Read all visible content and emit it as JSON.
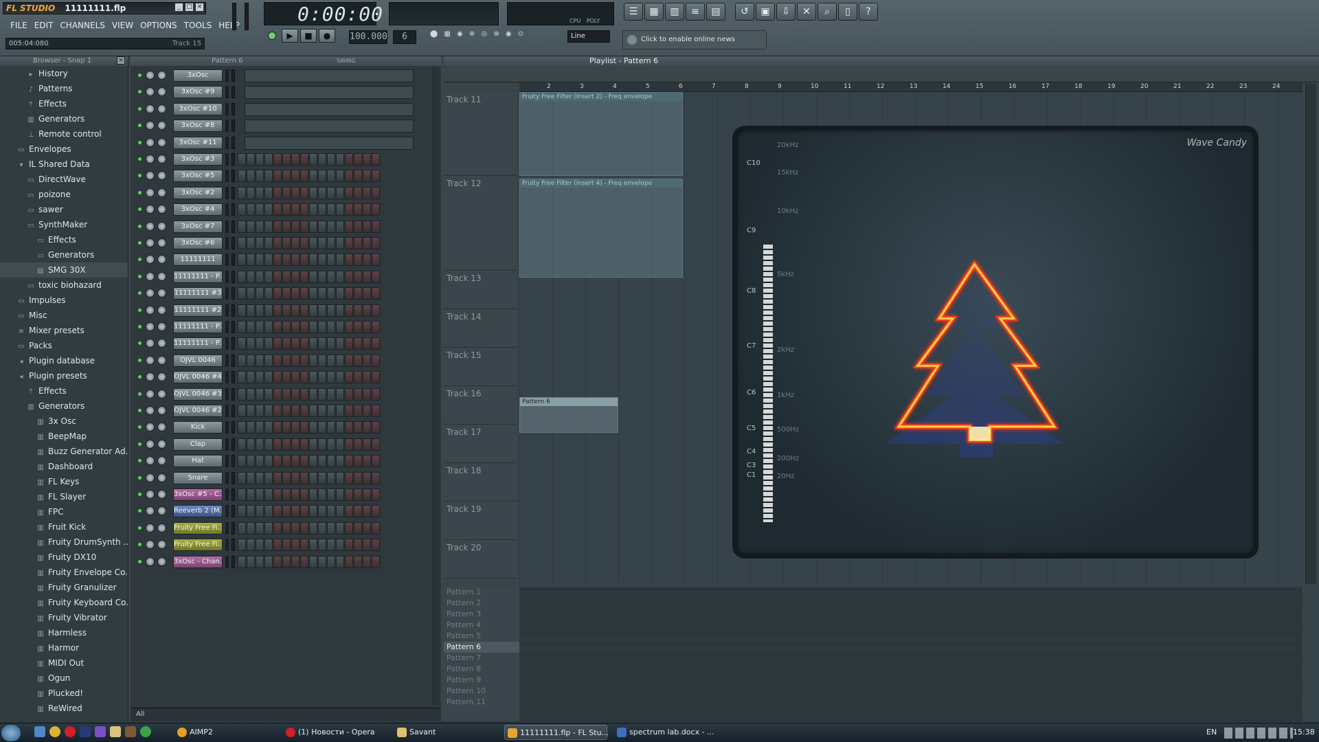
{
  "title_bar": {
    "app": "FL STUDIO",
    "file": "11111111.flp"
  },
  "menu": [
    "FILE",
    "EDIT",
    "CHANNELS",
    "VIEW",
    "OPTIONS",
    "TOOLS",
    "HELP"
  ],
  "hint": {
    "text": "005:04:080",
    "track": "Track 15"
  },
  "transport": {
    "time": "0:00:00",
    "tempo": "100.000",
    "pattern": "6",
    "snap": "Line",
    "cpu": "CPU",
    "poly": "POLY"
  },
  "news": "Click to enable online news",
  "browser": {
    "title": "Browser - Snap 1",
    "items": [
      "History",
      "Patterns",
      "Effects",
      "Generators",
      "Remote control",
      "Envelopes",
      "IL Shared Data",
      "DirectWave",
      "poizone",
      "sawer",
      "SynthMaker",
      "Effects",
      "Generators",
      "SMG 30X",
      "toxic biohazard",
      "Impulses",
      "Misc",
      "Mixer presets",
      "Packs",
      "Plugin database",
      "Plugin presets",
      "Effects",
      "Generators",
      "3x Osc",
      "BeepMap",
      "Buzz Generator Ad...",
      "Dashboard",
      "FL Keys",
      "FL Slayer",
      "FPC",
      "Fruit Kick",
      "Fruity DrumSynth ...",
      "Fruity DX10",
      "Fruity Envelope Co...",
      "Fruity Granulizer",
      "Fruity Keyboard Co...",
      "Fruity Vibrator",
      "Harmless",
      "Harmor",
      "MIDI Out",
      "Ogun",
      "Plucked!",
      "ReWired"
    ]
  },
  "rack": {
    "title": "Pattern 6",
    "swing": "SWING",
    "filter": "All",
    "channels": [
      "3xOsc",
      "3xOsc #9",
      "3xOsc #10",
      "3xOsc #8",
      "3xOsc #11",
      "3xOsc #3",
      "3xOsc #5",
      "3xOsc #2",
      "3xOsc #4",
      "3xOsc #7",
      "3xOsc #6",
      "11111111",
      "11111111 - P...",
      "11111111 #3",
      "11111111 #2",
      "11111111 - P...",
      "11111111 - P...",
      "OJVL 0046",
      "OJVL 0046 #4",
      "OJVL 0046 #3",
      "OJVL 0046 #2",
      "Kick",
      "Clap",
      "Hat",
      "Snare",
      "3xOsc #5 - C...",
      "Reeverb 2 (M...",
      "Fruity Free Fi...",
      "Fruity Free Fi...",
      "3xOsc - Chan..."
    ]
  },
  "playlist": {
    "title": "Playlist - Pattern 6",
    "ruler": [
      "2",
      "3",
      "4",
      "5",
      "6",
      "7",
      "8",
      "9",
      "10",
      "11",
      "12",
      "13",
      "14",
      "15",
      "16",
      "17",
      "18",
      "19",
      "20",
      "21",
      "22",
      "23",
      "24"
    ],
    "tracks": [
      "Track 11",
      "Track 12",
      "Track 13",
      "Track 14",
      "Track 15",
      "Track 16",
      "Track 17",
      "Track 18",
      "Track 19",
      "Track 20"
    ],
    "clips": [
      "Fruity Free Filter (Insert 2) - Freq envelope",
      "Fruity Free Filter (Insert 4) - Freq envelope",
      "Pattern 6"
    ],
    "patterns": [
      "Pattern 1",
      "Pattern 2",
      "Pattern 3",
      "Pattern 4",
      "Pattern 5",
      "Pattern 6",
      "Pattern 7",
      "Pattern 8",
      "Pattern 9",
      "Pattern 10",
      "Pattern 11"
    ]
  },
  "wave_candy": {
    "title": "Wave Candy",
    "notes": [
      "C10",
      "C9",
      "C8",
      "C7",
      "C6",
      "C5",
      "C4",
      "C3",
      "C1"
    ],
    "freqs": [
      "20kHz",
      "15kHz",
      "10kHz",
      "5kHz",
      "2kHz",
      "1kHz",
      "500Hz",
      "200Hz",
      "20Hz"
    ]
  },
  "taskbar": {
    "items": [
      "AIMP2",
      "(1) Новости - Opera",
      "Savant",
      "11111111.flp - FL Stu...",
      "spectrum lab.docx - ..."
    ],
    "lang": "EN",
    "clock": "15:38"
  }
}
